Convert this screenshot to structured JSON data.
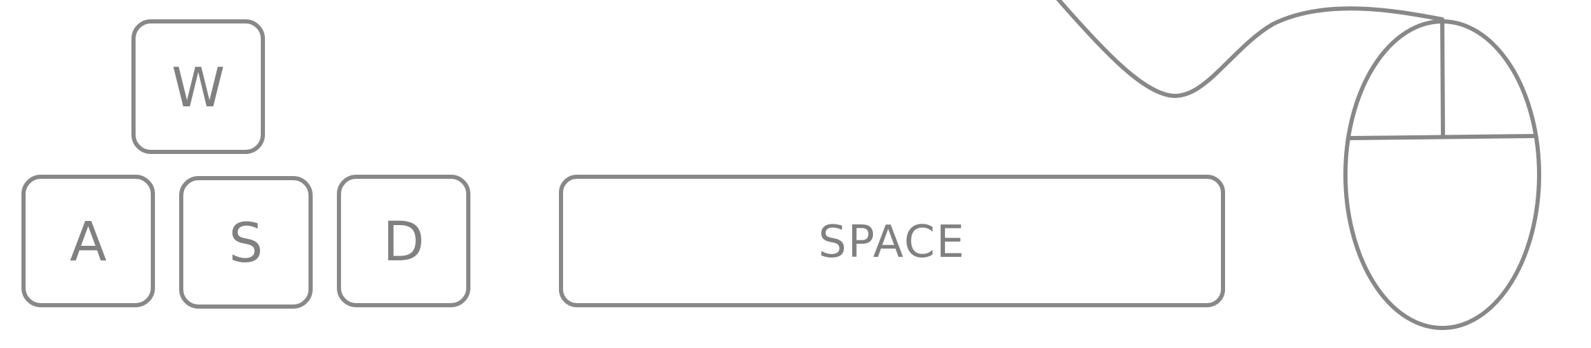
{
  "keys": {
    "w": "W",
    "a": "A",
    "s": "S",
    "d": "D",
    "space": "SPACE"
  },
  "colors": {
    "stroke": "#888888",
    "text": "#808080",
    "background": "#ffffff"
  },
  "icons": {
    "mouse": "computer-mouse-icon",
    "cable": "mouse-cable-icon"
  }
}
